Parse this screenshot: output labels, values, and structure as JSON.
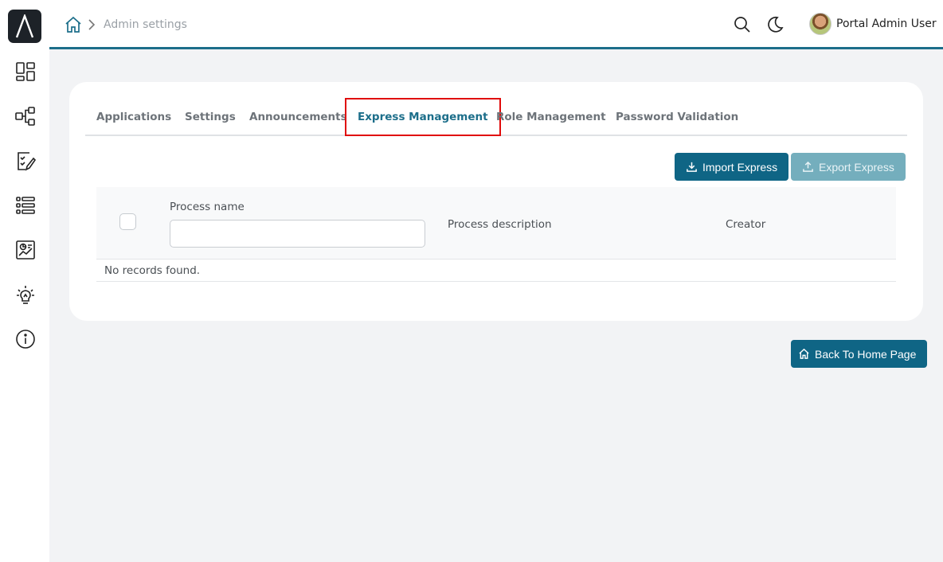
{
  "sidebar": {
    "logo_icon": "delta-logo-icon",
    "items": [
      {
        "name": "dashboard-icon"
      },
      {
        "name": "process-icon"
      },
      {
        "name": "task-icon"
      },
      {
        "name": "list-icon"
      },
      {
        "name": "statistics-icon"
      },
      {
        "name": "lightbulb-icon"
      },
      {
        "name": "info-icon"
      }
    ]
  },
  "header": {
    "breadcrumb": "Admin settings",
    "user_name": "Portal Admin User"
  },
  "tabs": [
    {
      "label": "Applications",
      "active": false
    },
    {
      "label": "Settings",
      "active": false
    },
    {
      "label": "Announcements",
      "active": false
    },
    {
      "label": "Express Management",
      "active": true
    },
    {
      "label": "Role Management",
      "active": false
    },
    {
      "label": "Password Validation",
      "active": false
    }
  ],
  "actions": {
    "import_label": "Import Express",
    "export_label": "Export Express"
  },
  "table": {
    "columns": {
      "name": "Process name",
      "description": "Process description",
      "creator": "Creator"
    },
    "filter_value": "",
    "empty_message": "No records found."
  },
  "footer": {
    "back_label": "Back To Home Page"
  },
  "colors": {
    "accent": "#0f6585",
    "highlight": "#e00b0b",
    "disabled": "#74aebd"
  }
}
